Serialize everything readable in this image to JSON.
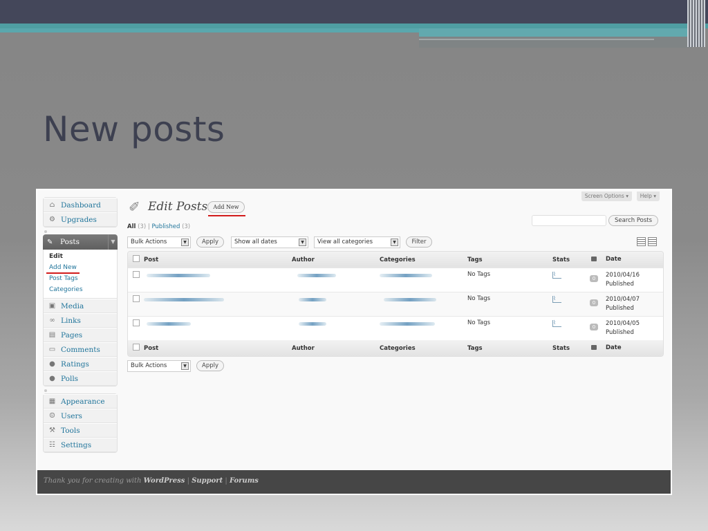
{
  "slide": {
    "title": "New posts"
  },
  "menu": {
    "dashboard": "Dashboard",
    "upgrades": "Upgrades",
    "posts": "Posts",
    "posts_sub": [
      "Edit",
      "Add New",
      "Post Tags",
      "Categories"
    ],
    "media": "Media",
    "links": "Links",
    "pages": "Pages",
    "comments": "Comments",
    "ratings": "Ratings",
    "polls": "Polls",
    "appearance": "Appearance",
    "users": "Users",
    "tools": "Tools",
    "settings": "Settings"
  },
  "header": {
    "title": "Edit Posts",
    "add_new": "Add New",
    "screen_options": "Screen Options ▾",
    "help": "Help ▾"
  },
  "filters": {
    "all": "All",
    "all_count": "(3)",
    "separator": "|",
    "published": "Published",
    "published_count": "(3)",
    "search_button": "Search Posts",
    "bulk_actions": "Bulk Actions",
    "apply": "Apply",
    "show_all_dates": "Show all dates",
    "view_all_categories": "View all categories",
    "filter": "Filter"
  },
  "table": {
    "columns": [
      "Post",
      "Author",
      "Categories",
      "Tags",
      "Stats",
      "Date"
    ],
    "rows": [
      {
        "tags": "No Tags",
        "comments": "0",
        "date": "2010/04/16",
        "status": "Published"
      },
      {
        "tags": "No Tags",
        "comments": "0",
        "date": "2010/04/07",
        "status": "Published"
      },
      {
        "tags": "No Tags",
        "comments": "0",
        "date": "2010/04/05",
        "status": "Published"
      }
    ]
  },
  "footer": {
    "text": "Thank you for creating with",
    "wordpress": "WordPress",
    "support": "Support",
    "forums": "Forums",
    "sep": "|"
  },
  "colors": {
    "link": "#21759b",
    "accent_red": "#d21b1b",
    "footer_bg": "#464646",
    "slide_title": "#3d4050"
  }
}
